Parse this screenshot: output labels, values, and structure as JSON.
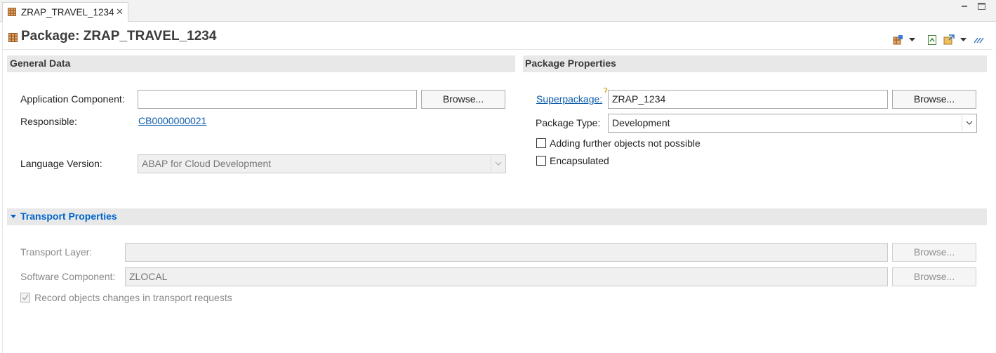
{
  "editor_tab": {
    "label": "ZRAP_TRAVEL_1234",
    "icon": "package-icon"
  },
  "header": {
    "title": "Package: ZRAP_TRAVEL_1234"
  },
  "general_data": {
    "title": "General Data",
    "application_component": {
      "label": "Application Component:",
      "value": "",
      "browse": "Browse..."
    },
    "responsible": {
      "label": "Responsible:",
      "value": "CB0000000021"
    },
    "language_version": {
      "label": "Language Version:",
      "value": "ABAP for Cloud Development"
    }
  },
  "package_properties": {
    "title": "Package Properties",
    "superpackage": {
      "label": "Superpackage:",
      "value": "ZRAP_1234",
      "browse": "Browse..."
    },
    "package_type": {
      "label": "Package Type:",
      "value": "Development"
    },
    "adding_objects": {
      "label": "Adding further objects not possible",
      "checked": false
    },
    "encapsulated": {
      "label": "Encapsulated",
      "checked": false
    }
  },
  "transport_properties": {
    "title": "Transport Properties",
    "transport_layer": {
      "label": "Transport Layer:",
      "value": "",
      "browse": "Browse..."
    },
    "software_component": {
      "label": "Software Component:",
      "value": "ZLOCAL",
      "browse": "Browse..."
    },
    "record_changes": {
      "label": "Record objects changes in transport requests",
      "checked": true
    }
  },
  "colors": {
    "link": "#0b5cad",
    "section_bg": "#e8e8e8",
    "section_link": "#0066cc"
  }
}
